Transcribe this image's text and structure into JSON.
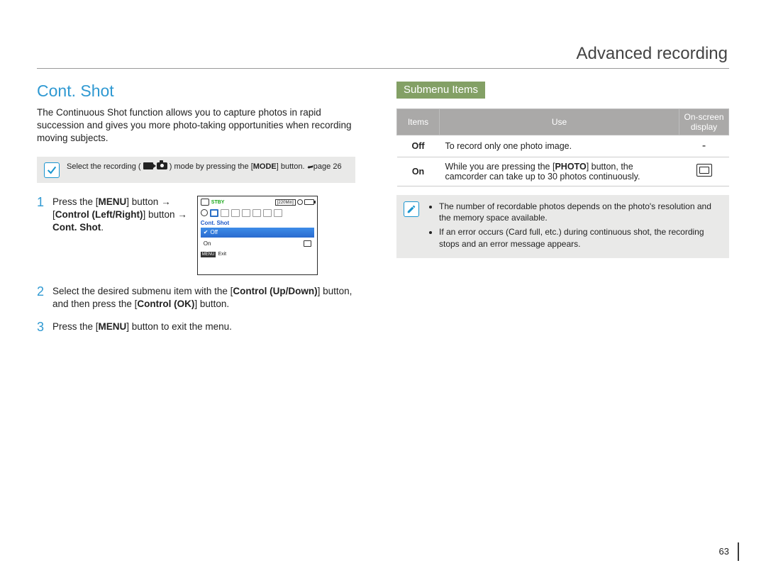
{
  "header": {
    "title": "Advanced recording"
  },
  "left": {
    "section_title": "Cont. Shot",
    "intro": "The Continuous Shot function allows you to capture photos in rapid succession and gives you more photo-taking opportunities when recording moving subjects.",
    "mode_note_prefix": "Select the recording (",
    "mode_note_mid": ") mode by pressing the [",
    "mode_note_mode": "MODE",
    "mode_note_suffix_a": "] button. ",
    "mode_note_pageref": "page 26",
    "steps": {
      "s1_num": "1",
      "s1_a": "Press the [",
      "s1_menu": "MENU",
      "s1_b": "] button ",
      "s1_arrow1": "→",
      "s1_c": " [",
      "s1_ctrl_lr": "Control (Left/Right)",
      "s1_d": "] button ",
      "s1_arrow2": "→",
      "s1_e": " ",
      "s1_target": "Cont. Shot",
      "s1_period": ".",
      "s2_num": "2",
      "s2_a": "Select the desired submenu item with the [",
      "s2_ctrl_ud": "Control (Up/Down)",
      "s2_b": "] button, and then press the [",
      "s2_ctrl_ok": "Control (OK)",
      "s2_c": "] button.",
      "s3_num": "3",
      "s3_a": "Press the [",
      "s3_menu": "MENU",
      "s3_b": "] button to exit the menu."
    },
    "lcd": {
      "stby": "STBY",
      "time": "[220Min]",
      "menutitle": "Cont. Shot",
      "opt_off": "Off",
      "opt_on": "On",
      "menu_label": "MENU",
      "exit": "Exit"
    }
  },
  "right": {
    "submenu_title": "Submenu Items",
    "th_items": "Items",
    "th_use": "Use",
    "th_onscreen": "On-screen display",
    "rows": [
      {
        "item": "Off",
        "use": "To record only one photo image.",
        "disp": "-"
      },
      {
        "item": "On",
        "use_a": "While you are pressing the [",
        "use_photo": "PHOTO",
        "use_b": "] button, the camcorder can take up to 30 photos continuously.",
        "disp": "icon"
      }
    ],
    "notes": [
      "The number of recordable photos depends on the photo's resolution and the memory space available.",
      "If an error occurs (Card full, etc.) during continuous shot, the recording stops and an error message appears."
    ]
  },
  "page_number": "63"
}
